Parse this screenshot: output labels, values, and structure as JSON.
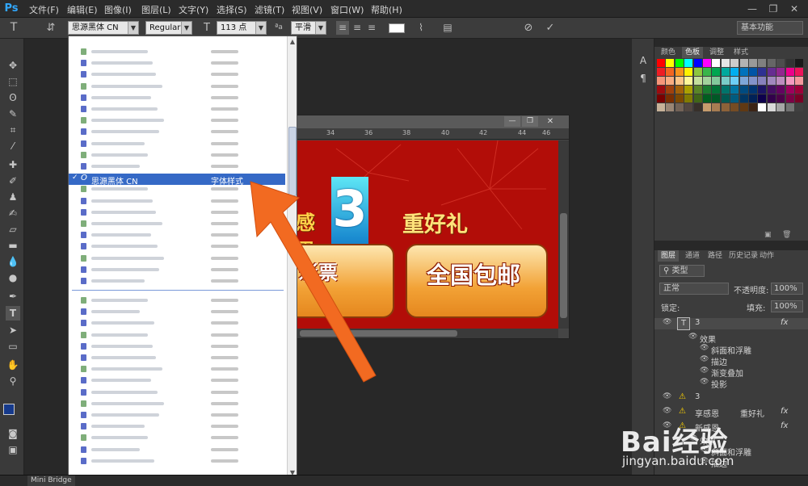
{
  "app": {
    "logo": "Ps"
  },
  "menu": [
    "文件(F)",
    "编辑(E)",
    "图像(I)",
    "图层(L)",
    "文字(Y)",
    "选择(S)",
    "滤镜(T)",
    "视图(V)",
    "窗口(W)",
    "帮助(H)"
  ],
  "window_controls": {
    "minimize": "—",
    "restore": "❐",
    "close": "✕"
  },
  "options": {
    "font_family": "思源黑体 CN",
    "font_style": "Regular",
    "font_size": "113 点",
    "antialias": "平滑",
    "workspace": "基本功能"
  },
  "font_list": {
    "selected_name": "思源黑体 CN",
    "selected_sample": "字体样式"
  },
  "ruler": [
    "34",
    "36",
    "38",
    "40",
    "42",
    "44",
    "46"
  ],
  "artwork": {
    "text_line1_left": "感恩",
    "big_digit": "3",
    "text_line1_right": "重好礼",
    "button_left": "彩票",
    "button_right": "全国包邮"
  },
  "swatches": {
    "tabs": [
      "颜色",
      "色板",
      "调整",
      "样式"
    ],
    "active_tab": "色板"
  },
  "layers": {
    "tabs": [
      "图层",
      "通道",
      "路径",
      "历史记录",
      "动作"
    ],
    "filter": "类型",
    "blend_mode": "正常",
    "opacity_label": "不透明度:",
    "opacity": "100%",
    "lock_label": "锁定:",
    "fill_label": "填充:",
    "fill": "100%",
    "items": [
      {
        "name": "3",
        "kind": "text",
        "fx": "fx"
      },
      {
        "name": "效果",
        "kind": "effects-header"
      },
      {
        "name": "斜面和浮雕",
        "kind": "effect"
      },
      {
        "name": "描边",
        "kind": "effect"
      },
      {
        "name": "渐变叠加",
        "kind": "effect"
      },
      {
        "name": "投影",
        "kind": "effect"
      },
      {
        "name": "3",
        "kind": "warning"
      },
      {
        "name": "享感恩",
        "kind": "text-warning",
        "extra": "重好礼",
        "fx": "fx"
      },
      {
        "name": "新感恩",
        "kind": "text-warning",
        "fx": "fx"
      },
      {
        "name": "效果",
        "kind": "effects-header"
      },
      {
        "name": "斜面和浮雕",
        "kind": "effect"
      },
      {
        "name": "描边",
        "kind": "effect"
      }
    ]
  },
  "bottom": {
    "mini_bridge": "Mini Bridge"
  },
  "watermark": {
    "brand": "Bai经验",
    "url": "jingyan.baidu.com"
  },
  "colors": {
    "selected_row": "#3569c6",
    "arrow": "#f26a21",
    "banner": "#b20d08"
  }
}
